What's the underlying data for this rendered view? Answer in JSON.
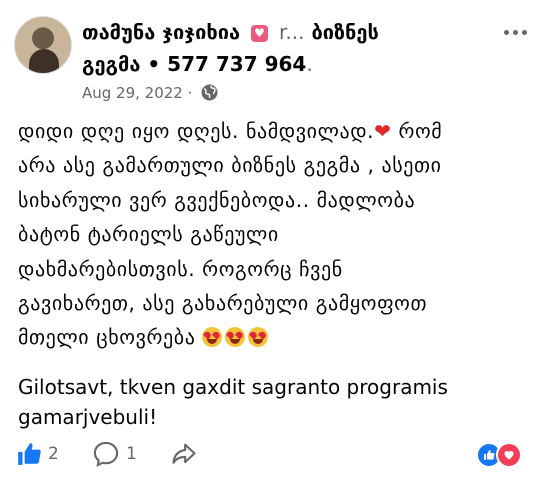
{
  "post": {
    "author_name": "თამუნა ჯიჯიხია",
    "badge": "💟",
    "truncated_name": "r...",
    "title_part1": "ბიზნეს",
    "title_part2": "გეგმა",
    "separator": "•",
    "phone": "577 737 964",
    "date": "Aug 29, 2022",
    "dot": "·",
    "body_lines": [
      "დიდი დღე იყო დღეს. ნამდვილად.",
      "რომ",
      "არა ასე გამართული ბიზნეს გეგმა , ასეთი",
      "სიხარული ვერ გვექნებოდა.. მადლობა",
      "ბატონ ტარიელს გაწეული",
      "დახმარებისთვის. როგორც ჩვენ",
      "გავიხარეთ, ასე გახარებული გამყოფოთ",
      "მთელი ცხოვრება"
    ],
    "heart_emoji": "❤",
    "latin_text": "Gilotsavt, tkven gaxdit sagranto programis gamarjvebuli!",
    "likes_count": "2",
    "comments_count": "1"
  },
  "colors": {
    "primary_text": "#050505",
    "secondary_text": "#65676b",
    "like_blue": "#1877f2",
    "love_red": "#f33e58"
  },
  "icons": [
    "globe-icon",
    "more-options-icon",
    "like-icon",
    "comment-icon",
    "share-icon",
    "like-reaction-icon",
    "love-reaction-icon",
    "heart-eyes-emoji"
  ]
}
